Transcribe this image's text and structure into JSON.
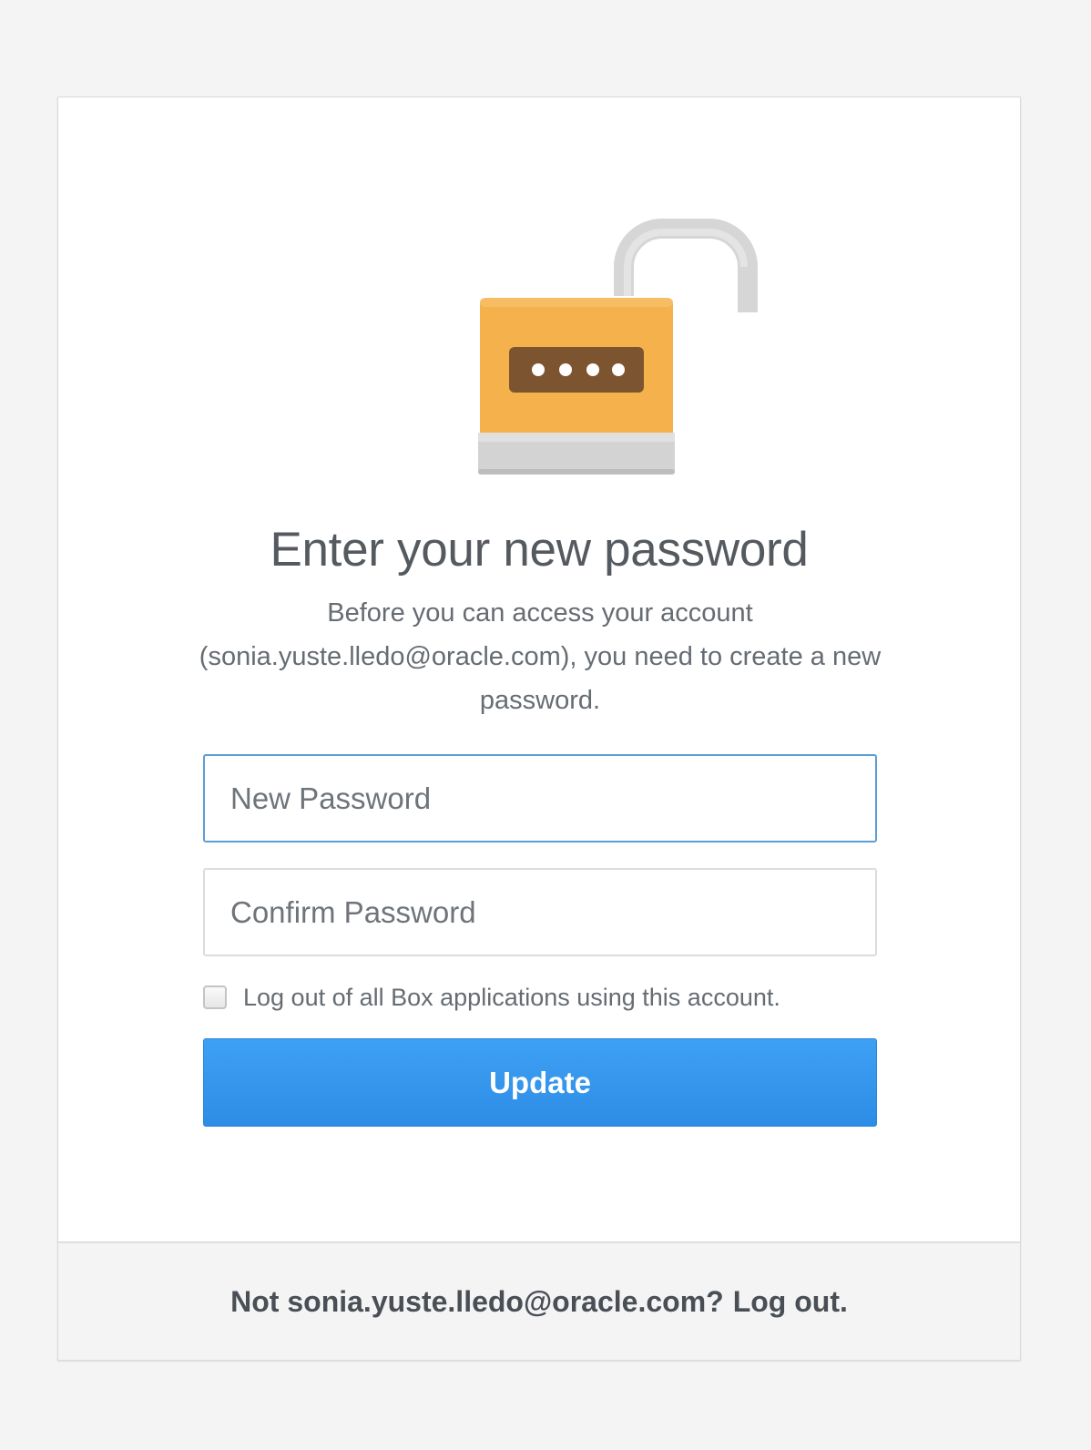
{
  "page": {
    "title": "Enter your new password",
    "subtitle": "Before you can access your account (sonia.yuste.lledo@oracle.com), you need to create a new password."
  },
  "form": {
    "new_password_placeholder": "New Password",
    "confirm_password_placeholder": "Confirm Password",
    "logout_all_label": "Log out of all Box applications using this account.",
    "logout_all_checked": false,
    "update_label": "Update"
  },
  "footer": {
    "prefix": "Not sonia.yuste.lledo@oracle.com?",
    "logout_link": "Log out."
  },
  "icons": {
    "lock": "unlocked-padlock-icon",
    "lock_body_color": "#f5b14c",
    "lock_shackle_color": "#d9d9d9",
    "lock_slot_color": "#7c5530"
  },
  "colors": {
    "accent": "#2d8de6",
    "focus_border": "#5b9fd6",
    "page_background": "#f4f4f5"
  }
}
